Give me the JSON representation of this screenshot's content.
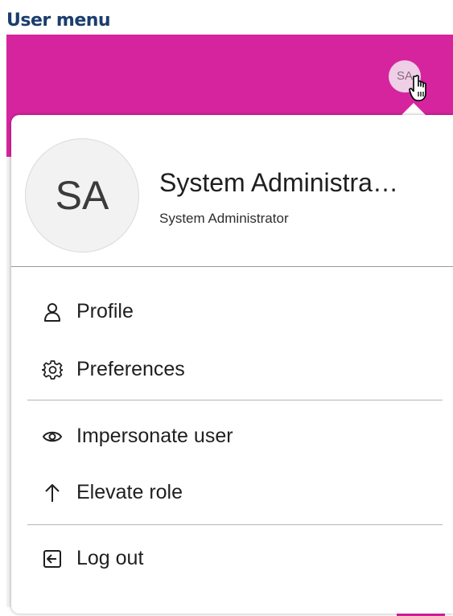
{
  "caption": "User menu",
  "header": {
    "avatar_initials": "SA"
  },
  "user_card": {
    "initials": "SA",
    "name": "System Administra…",
    "role": "System Administrator"
  },
  "menu": {
    "items": [
      {
        "label": "Profile",
        "icon": "person-icon"
      },
      {
        "label": "Preferences",
        "icon": "gear-icon"
      },
      {
        "label": "Impersonate user",
        "icon": "eye-icon"
      },
      {
        "label": "Elevate role",
        "icon": "arrow-up-icon"
      },
      {
        "label": "Log out",
        "icon": "logout-icon"
      }
    ]
  },
  "colors": {
    "header_bar": "#d6249f",
    "caption": "#1b3d6e",
    "small_avatar_bg": "#eecfe5"
  }
}
